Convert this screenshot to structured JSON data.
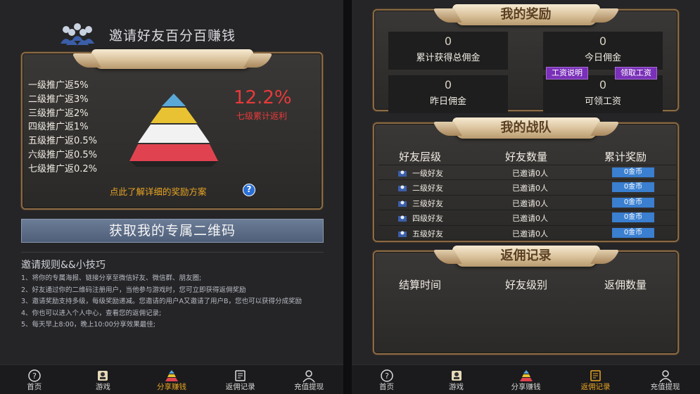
{
  "left": {
    "header_title": "邀请好友百分百赚钱",
    "levels_panel": {
      "levels": [
        "一级推广返5%",
        "二级推广返3%",
        "三级推广返2%",
        "四级推广返1%",
        "五级推广返0.5%",
        "六级推广返0.5%",
        "七级推广返0.2%"
      ],
      "total_rate": "12.2%",
      "total_rate_label": "七级累计返利",
      "plan_link": "点此了解详细的奖励方案",
      "help_glyph": "?"
    },
    "qr_button": "获取我的专属二维码",
    "rules_title": "邀请规则&&小技巧",
    "rules": [
      "1、将你的专属海报、链接分享至微信好友、微信群、朋友圈;",
      "2、好友通过你的二维码注册用户，当他参与游戏时，您可立即获得返佣奖励",
      "3、邀请奖励支持多级，每级奖励递减。您邀请的用户A又邀请了用户B，您也可以获得分成奖励",
      "4、你也可以进入个人中心，查看您的返佣记录;",
      "5、每天早上8:00，晚上10:00分享效果最佳;"
    ]
  },
  "right": {
    "reward_panel": {
      "title": "我的奖励",
      "total_commission": {
        "value": "0",
        "label": "累计获得总佣金"
      },
      "today_commission": {
        "value": "0",
        "label": "今日佣金"
      },
      "yesterday_commission": {
        "value": "0",
        "label": "昨日佣金"
      },
      "claimable_wage": {
        "value": "0",
        "label": "可领工资"
      },
      "wage_info_button": "工资说明",
      "claim_wage_button": "领取工资"
    },
    "team_panel": {
      "title": "我的战队",
      "headers": [
        "好友层级",
        "好友数量",
        "累计奖励"
      ],
      "rows": [
        {
          "level": "一级好友",
          "invited": "已邀请0人",
          "reward": "0金币"
        },
        {
          "level": "二级好友",
          "invited": "已邀请0人",
          "reward": "0金币"
        },
        {
          "level": "三级好友",
          "invited": "已邀请0人",
          "reward": "0金币"
        },
        {
          "level": "四级好友",
          "invited": "已邀请0人",
          "reward": "0金币"
        },
        {
          "level": "五级好友",
          "invited": "已邀请0人",
          "reward": "0金币"
        }
      ]
    },
    "record_panel": {
      "title": "返佣记录",
      "headers": [
        "结算时间",
        "好友级别",
        "返佣数量"
      ]
    }
  },
  "nav": {
    "items": [
      "首页",
      "游戏",
      "分享赚钱",
      "返佣记录",
      "充值提现"
    ],
    "left_active": "分享赚钱",
    "right_active": "返佣记录"
  },
  "colors": {
    "accent_gold": "#e8a423",
    "rate_red": "#e83a3a",
    "coin_blue": "#3a7fd0",
    "button_purple": "#7a30b8"
  }
}
